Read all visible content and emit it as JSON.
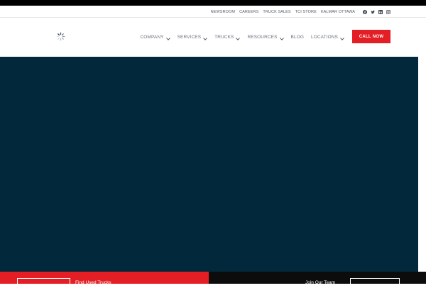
{
  "utility_bar": {
    "links": [
      "NEWSROOM",
      "CAREERS",
      "TRUCK SALES",
      "TCI STORE",
      "KALMAR OTTAWA"
    ],
    "social_icons": [
      "facebook-icon",
      "twitter-icon",
      "linkedin-icon",
      "instagram-icon"
    ]
  },
  "nav": {
    "items": [
      {
        "label": "COMPANY",
        "has_dropdown": true
      },
      {
        "label": "SERVICES",
        "has_dropdown": true
      },
      {
        "label": "TRUCKS",
        "has_dropdown": true
      },
      {
        "label": "RESOURCES",
        "has_dropdown": true
      },
      {
        "label": "BLOG",
        "has_dropdown": false
      },
      {
        "label": "LOCATIONS",
        "has_dropdown": true
      }
    ],
    "cta_label": "CALL NOW"
  },
  "colors": {
    "brand_red": "#e31e24",
    "hero_navy": "#02293b",
    "dark_band": "#0c0c0c"
  },
  "bottom_band": {
    "left_text": "Find Used Trucks",
    "right_text": "Join Our Team"
  }
}
